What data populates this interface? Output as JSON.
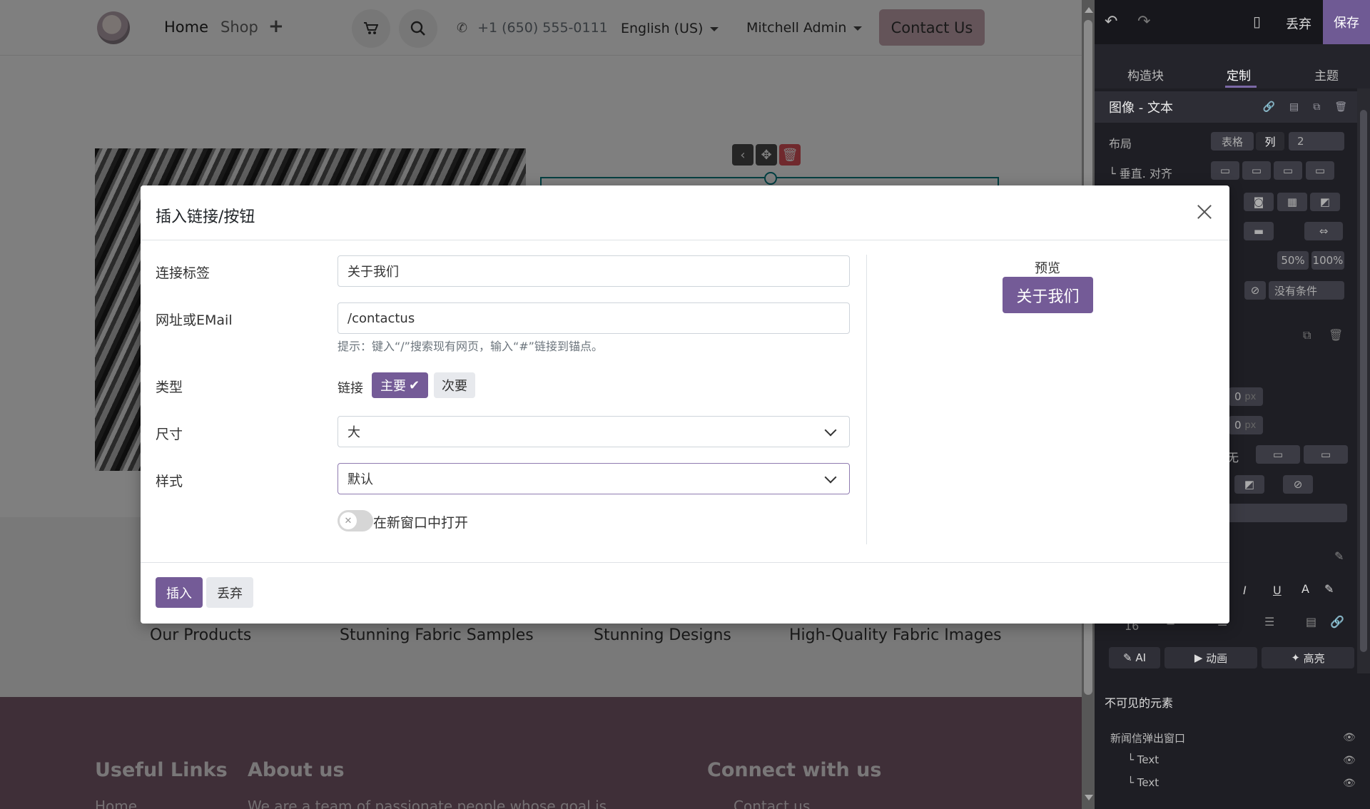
{
  "navbar": {
    "home": "Home",
    "shop": "Shop",
    "plus": "+",
    "phone": "+1 (650) 555-0111",
    "language": "English (US)",
    "user": "Mitchell Admin",
    "contact_button": "Contact Us"
  },
  "page": {
    "products": [
      "Our Products",
      "Stunning Fabric Samples",
      "Stunning Designs",
      "High-Quality Fabric Images"
    ],
    "footer": {
      "useful_links": "Useful Links",
      "about_us": "About us",
      "connect": "Connect with us",
      "home_link": "Home",
      "about_text": "We are a team of passionate people whose goal is",
      "contact_link": "Contact us"
    }
  },
  "editor": {
    "discard": "丢弃",
    "save": "保存",
    "tabs": [
      "构造块",
      "定制",
      "主题"
    ],
    "section_title": "图像 - 文本",
    "layout_label": "布局",
    "layout_options": [
      "表格",
      "列"
    ],
    "columns_value": "2",
    "valign_label": "└ 垂直. 对齐",
    "size_options": [
      "50%",
      "100%"
    ],
    "condition": "没有条件",
    "px_value_1": "0",
    "px_value_2": "0",
    "px_unit": "px",
    "font_size": "16",
    "none_text": "无",
    "ai_button": "AI",
    "animate_button": "动画",
    "highlight_button": "高亮",
    "invisible_title": "不可见的元素",
    "invisible_items": [
      "新闻信弹出窗口",
      "└ Text",
      "└ Text"
    ]
  },
  "modal": {
    "title": "插入链接/按钮",
    "label_field_label": "连接标签",
    "label_value": "关于我们",
    "url_label": "网址或EMail",
    "url_value": "/contactus",
    "hint": "提示：键入“/”搜索现有网页，输入“#”链接到锚点。",
    "type_label": "类型",
    "type_link": "链接",
    "type_primary": "主要",
    "type_secondary": "次要",
    "size_label": "尺寸",
    "size_value": "大",
    "style_label": "样式",
    "style_value": "默认",
    "new_window": "在新窗口中打开",
    "preview_label": "预览",
    "preview_button": "关于我们",
    "insert": "插入",
    "discard": "丢弃"
  }
}
